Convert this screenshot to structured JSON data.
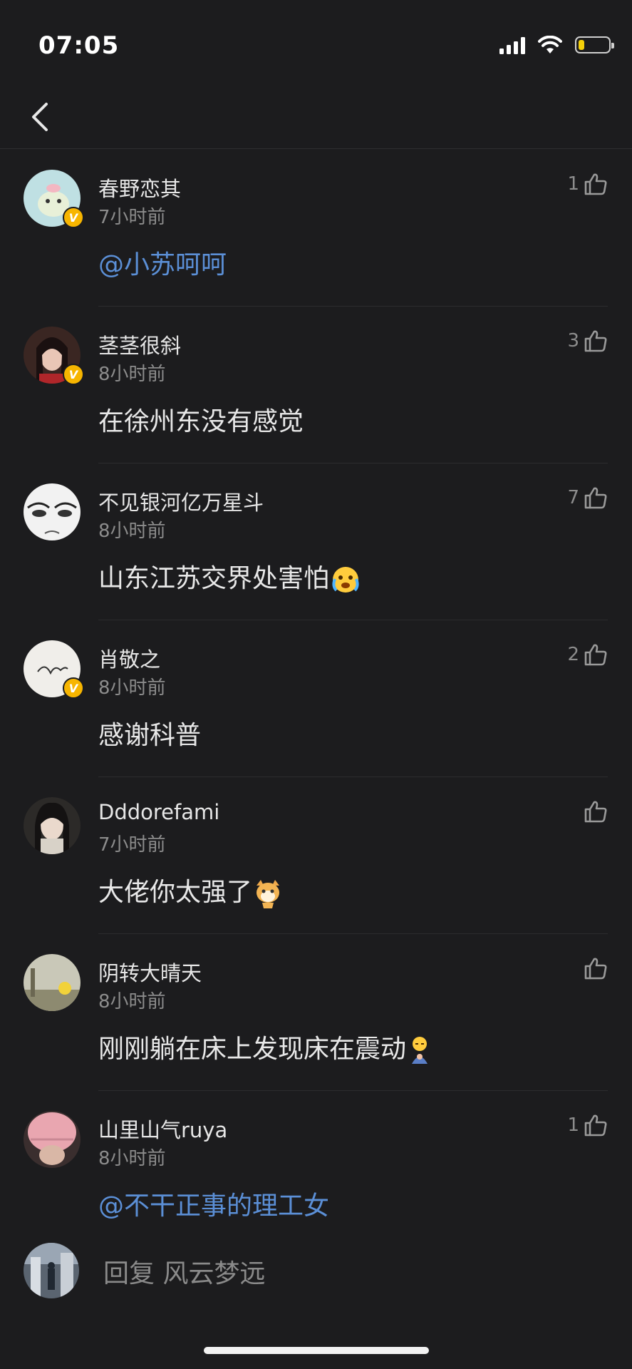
{
  "status_bar": {
    "time": "07:05",
    "battery_level": 0.2,
    "battery_color": "#f5d00a"
  },
  "nav": {
    "back_icon": "chevron-left-icon"
  },
  "accent": {
    "mention_color": "#5b8fd6",
    "verified_color": "#f7b500"
  },
  "comments": [
    {
      "username": "春野恋其",
      "time": "7小时前",
      "text": "@小苏呵呵",
      "mention": true,
      "likes": "1",
      "verified": true
    },
    {
      "username": "茎茎很斜",
      "time": "8小时前",
      "text": "在徐州东没有感觉",
      "mention": false,
      "likes": "3",
      "verified": true
    },
    {
      "username": "不见银河亿万星斗",
      "time": "8小时前",
      "text": "山东江苏交界处害怕",
      "emoji": "crying-face-emoji",
      "mention": false,
      "likes": "7",
      "verified": false
    },
    {
      "username": "肖敬之",
      "time": "8小时前",
      "text": "感谢科普",
      "mention": false,
      "likes": "2",
      "verified": true
    },
    {
      "username": "Dddorefami",
      "time": "7小时前",
      "text": "大佬你太强了",
      "emoji": "shiba-dog-emoji",
      "mention": false,
      "likes": "",
      "verified": false
    },
    {
      "username": "阴转大晴天",
      "time": "8小时前",
      "text": "刚刚躺在床上发现床在震动",
      "emoji": "shy-person-emoji",
      "mention": false,
      "likes": "",
      "verified": false
    },
    {
      "username": "山里山气ruya",
      "time": "8小时前",
      "text": "@不干正事的理工女",
      "mention": true,
      "likes": "1",
      "verified": false
    }
  ],
  "reply": {
    "placeholder": "回复 风云梦远"
  }
}
